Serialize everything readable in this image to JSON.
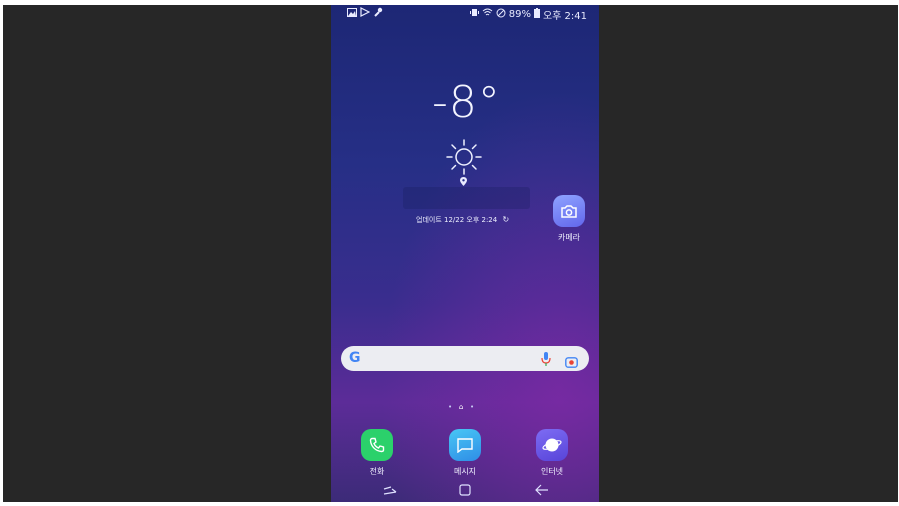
{
  "status_bar": {
    "left_icons": [
      "gallery-icon",
      "play-store-icon",
      "wrench-icon"
    ],
    "right_icons": [
      "vibrate-icon",
      "wifi-icon",
      "do-not-disturb-icon",
      "battery-icon"
    ],
    "battery": "89%",
    "time": "오후 2:41"
  },
  "weather": {
    "temperature": "-8°",
    "condition_icon": "sun-icon",
    "location_icon": "location-pin-icon",
    "update_text": "업데이트 12/22 오후 2:24"
  },
  "camera_app": {
    "label": "카메라",
    "icon": "camera-icon",
    "color": "#6f86f2"
  },
  "search_bar": {
    "logo": "G",
    "icons": [
      "mic-icon",
      "google-lens-icon"
    ]
  },
  "page_indicator": {
    "pages": 3,
    "current": 2
  },
  "dock": [
    {
      "label": "전화",
      "icon": "phone-icon",
      "color": "#2bd16b"
    },
    {
      "label": "메시지",
      "icon": "message-icon",
      "color": "#3aa8f0"
    },
    {
      "label": "인터넷",
      "icon": "internet-icon",
      "color": "#6b55e6"
    }
  ],
  "nav_bar": [
    "recent-apps-icon",
    "home-icon",
    "back-icon"
  ]
}
